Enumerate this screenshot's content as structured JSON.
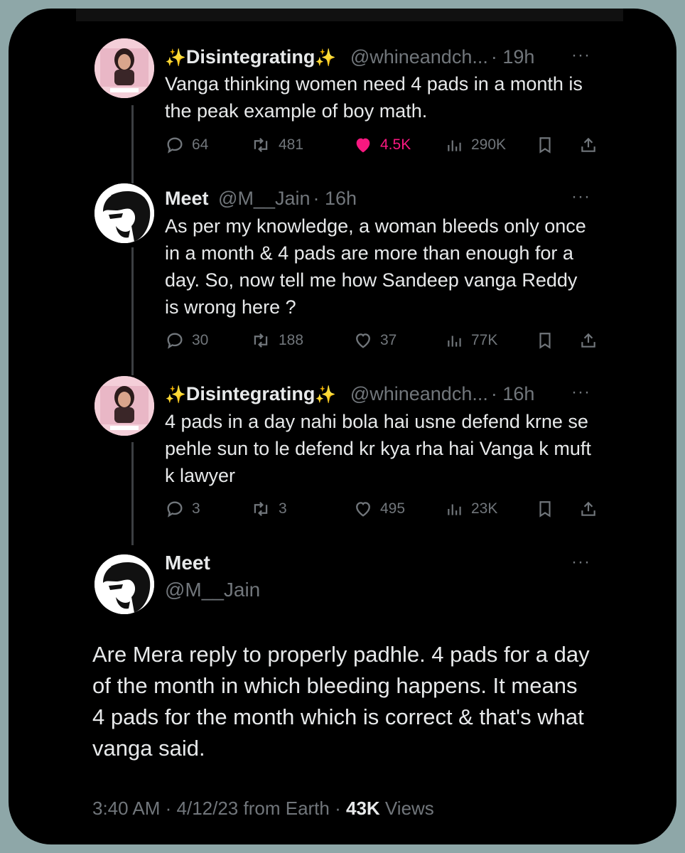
{
  "tweets": [
    {
      "name": "Disintegrating",
      "handle": "@whineandch...",
      "time": "· 19h",
      "more": "···",
      "text": "Vanga thinking women need 4 pads in a month is the peak example of boy math.",
      "replies": "64",
      "retweets": "481",
      "likes": "4.5K",
      "views": "290K",
      "liked": true,
      "avatar": "profile-photo-woman"
    },
    {
      "name": "Meet",
      "handle": "@M__Jain",
      "time": "· 16h",
      "more": "···",
      "text": "As per my knowledge, a woman bleeds only once in a month & 4 pads are more than enough for a day. So, now tell me how Sandeep vanga Reddy is wrong here ?",
      "replies": "30",
      "retweets": "188",
      "likes": "37",
      "views": "77K",
      "liked": false,
      "avatar": "profile-illustration-man"
    },
    {
      "name": "Disintegrating",
      "handle": "@whineandch...",
      "time": "· 16h",
      "more": "···",
      "text": "4 pads in a day nahi bola hai usne defend krne se pehle sun to le defend kr kya rha hai Vanga k muft k lawyer",
      "replies": "3",
      "retweets": "3",
      "likes": "495",
      "views": "23K",
      "liked": false,
      "avatar": "profile-photo-woman"
    }
  ],
  "main_tweet": {
    "name": "Meet",
    "handle": "@M__Jain",
    "more": "···",
    "text": "Are Mera reply to properly padhle. 4 pads for a day of the month in which bleeding happens. It means 4 pads for the month which is correct & that's what vanga said.",
    "time": "3:40 AM",
    "date": "4/12/23",
    "source": "from Earth",
    "views_count": "43K",
    "views_label": "Views"
  },
  "colors": {
    "background": "#000000",
    "primary_text": "#e7e9ea",
    "secondary_text": "#71767b",
    "like": "#f91880",
    "sparkle": "#ffd43b",
    "frame": "#8ea7a8"
  }
}
